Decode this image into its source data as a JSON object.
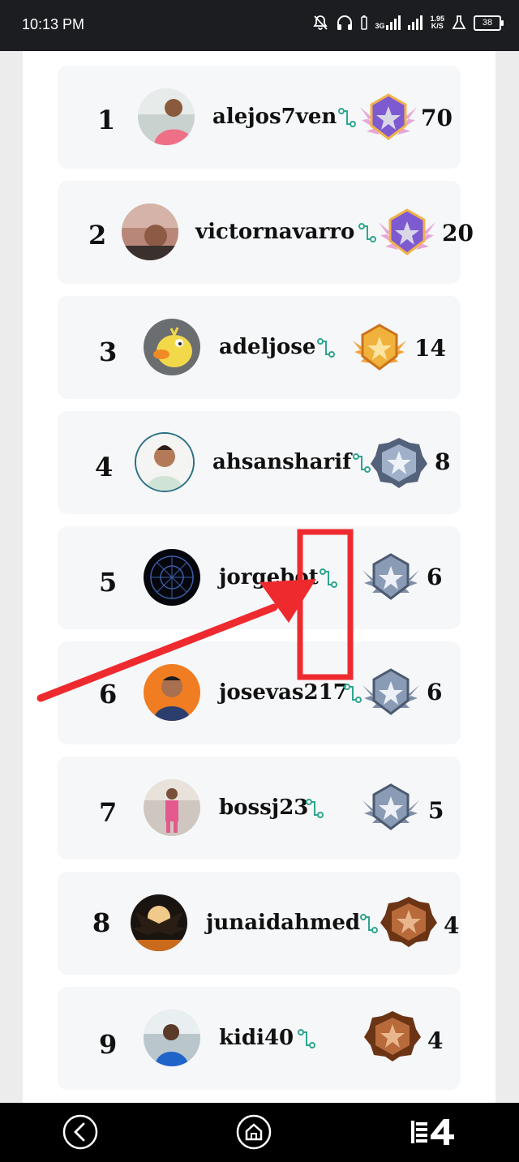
{
  "status_bar": {
    "time": "10:13 PM",
    "network_type": "3G",
    "data_speed_value": "1.95",
    "data_speed_unit": "K/S",
    "battery": "38"
  },
  "leaderboard": [
    {
      "rank": "1",
      "username": "alejos7ven",
      "score": "70",
      "badge": "purple-winged-star"
    },
    {
      "rank": "2",
      "username": "victornavarro",
      "score": "20",
      "badge": "purple-winged-star"
    },
    {
      "rank": "3",
      "username": "adeljose",
      "score": "14",
      "badge": "gold-star"
    },
    {
      "rank": "4",
      "username": "ahsansharif",
      "score": "8",
      "badge": "silver-star"
    },
    {
      "rank": "5",
      "username": "jorgebot",
      "score": "6",
      "badge": "silver-winged-star"
    },
    {
      "rank": "6",
      "username": "josevas217",
      "score": "6",
      "badge": "silver-winged-star"
    },
    {
      "rank": "7",
      "username": "bossj23",
      "score": "5",
      "badge": "silver-winged-star"
    },
    {
      "rank": "8",
      "username": "junaidahmed",
      "score": "4",
      "badge": "bronze-star"
    },
    {
      "rank": "9",
      "username": "kidi40",
      "score": "4",
      "badge": "bronze-star"
    }
  ],
  "nav_bar": {
    "back_icon": "back-icon",
    "home_icon": "home-icon",
    "app_icon": "app-logo-icon"
  },
  "annotation": {
    "color": "#ee2a2f"
  }
}
